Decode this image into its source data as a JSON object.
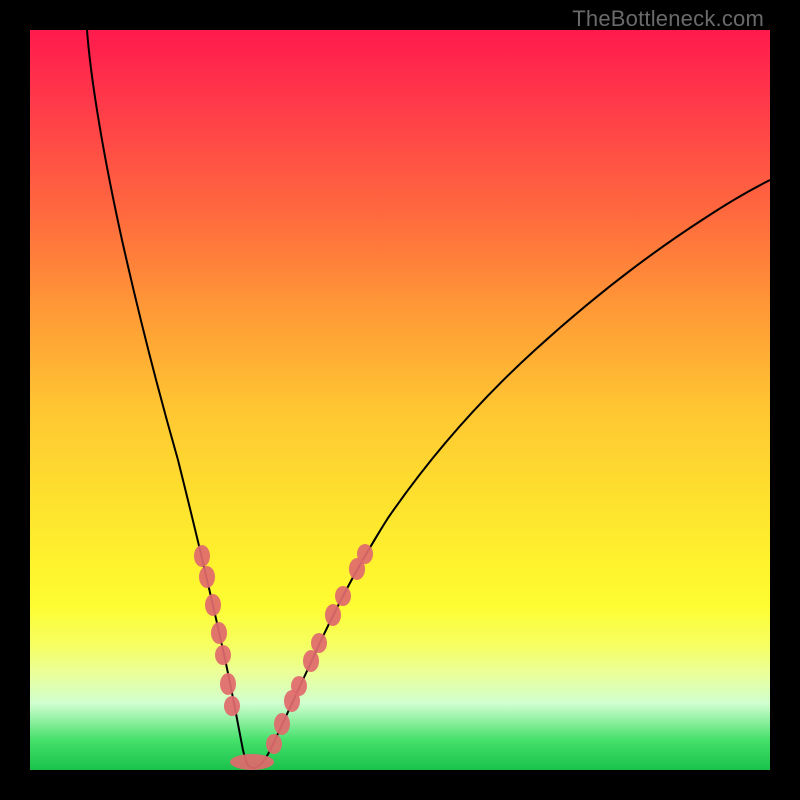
{
  "watermark": "TheBottleneck.com",
  "colors": {
    "page_bg": "#000000",
    "curve": "#000000",
    "bead": "#e06a6d",
    "gradient_top": "#ff1a4d",
    "gradient_bottom": "#19c24a"
  },
  "chart_data": {
    "type": "line",
    "title": "",
    "xlabel": "",
    "ylabel": "",
    "x": [
      0,
      5,
      10,
      15,
      20,
      22,
      24,
      26,
      28,
      30,
      32,
      34,
      36,
      40,
      45,
      50,
      60,
      70,
      80,
      90,
      100
    ],
    "values": [
      100,
      82,
      60,
      38,
      18,
      10,
      5,
      1,
      0,
      0,
      1,
      4,
      8,
      16,
      26,
      35,
      49,
      59,
      66,
      72,
      77
    ],
    "xlim": [
      0,
      100
    ],
    "ylim": [
      0,
      100
    ],
    "note": "Values are visually estimated from the plotted curve (0 = curve bottom / green zone, 100 = top / red zone). No axes, ticks, or labels are rendered in the figure.",
    "highlighted_x_ranges": [
      [
        20,
        26
      ],
      [
        30,
        36
      ]
    ]
  }
}
